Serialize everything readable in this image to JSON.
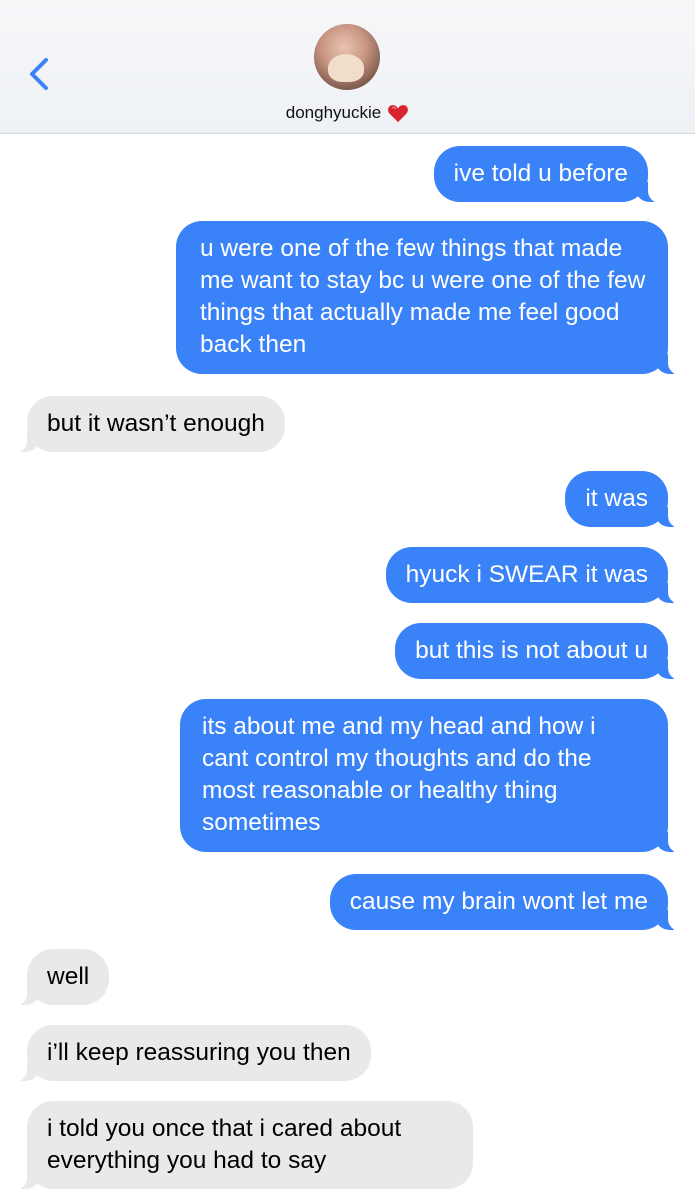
{
  "header": {
    "contact_name": "donghyuckie",
    "back_icon": "chevron-left-icon",
    "heart_icon": "red-heart-emoji",
    "accent": "#3a82f7"
  },
  "messages": [
    {
      "from": "me",
      "text": "ive told u before"
    },
    {
      "from": "me",
      "text": "u were one of the few things that made me want to stay bc u were one of the few things that actually made me feel good back then"
    },
    {
      "from": "them",
      "text": "but it wasn’t enough"
    },
    {
      "from": "me",
      "text": "it was"
    },
    {
      "from": "me",
      "text": "hyuck i SWEAR it was"
    },
    {
      "from": "me",
      "text": "but this is not about u"
    },
    {
      "from": "me",
      "text": "its about me and my head and how i cant control my thoughts and do the most reasonable or healthy thing sometimes"
    },
    {
      "from": "me",
      "text": "cause my brain wont let me"
    },
    {
      "from": "them",
      "text": "well"
    },
    {
      "from": "them",
      "text": "i’ll keep reassuring you then"
    },
    {
      "from": "them",
      "text": "i told you once that i cared about everything you had to say"
    }
  ]
}
